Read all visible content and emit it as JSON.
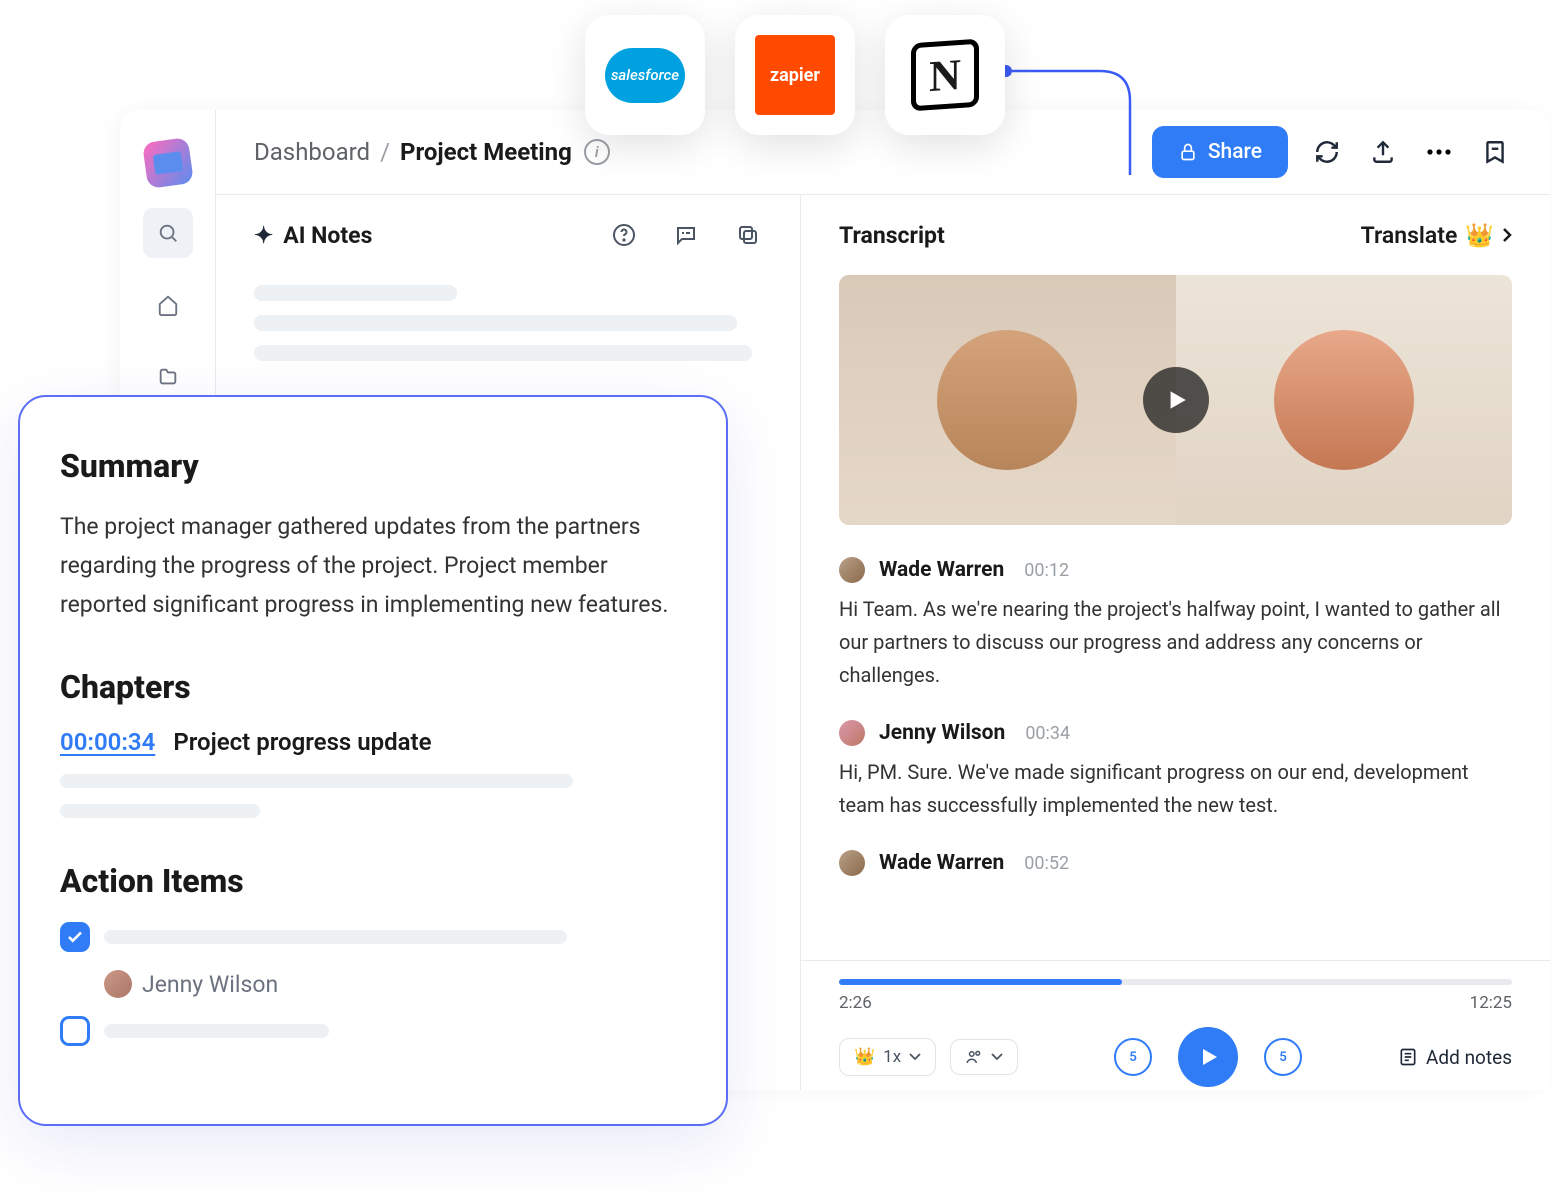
{
  "integrations": [
    "salesforce",
    "zapier",
    "Notion"
  ],
  "integration_labels": {
    "sf": "salesforce",
    "zap": "zapier",
    "notion": "N"
  },
  "sidebar": {
    "items": [
      "search",
      "home",
      "folder"
    ]
  },
  "header": {
    "crumb_root": "Dashboard",
    "crumb_active": "Project Meeting",
    "share_label": "Share"
  },
  "ai_notes": {
    "title": "AI Notes"
  },
  "summary_panel": {
    "summary_h": "Summary",
    "summary_body": "The project manager gathered updates from the partners regarding the progress of the project. Project member reported significant progress in implementing new features.",
    "chapters_h": "Chapters",
    "chapters": [
      {
        "time": "00:00:34",
        "title": "Project progress update"
      }
    ],
    "action_h": "Action Items",
    "action_items": [
      {
        "checked": true,
        "assignee": "Jenny Wilson"
      },
      {
        "checked": false
      }
    ]
  },
  "transcript": {
    "title": "Transcript",
    "translate_label": "Translate",
    "entries": [
      {
        "speaker": "Wade Warren",
        "time": "00:12",
        "text": "Hi Team. As we're nearing the project's halfway point, I wanted to gather all our partners to discuss our progress and address any concerns or challenges."
      },
      {
        "speaker": "Jenny Wilson",
        "time": "00:34",
        "text": "Hi, PM. Sure. We've made significant progress on our end, development team has successfully implemented the new test."
      },
      {
        "speaker": "Wade Warren",
        "time": "00:52",
        "text": ""
      }
    ]
  },
  "player": {
    "current": "2:26",
    "total": "12:25",
    "speed": "1x",
    "skip": "5",
    "add_notes": "Add notes"
  }
}
